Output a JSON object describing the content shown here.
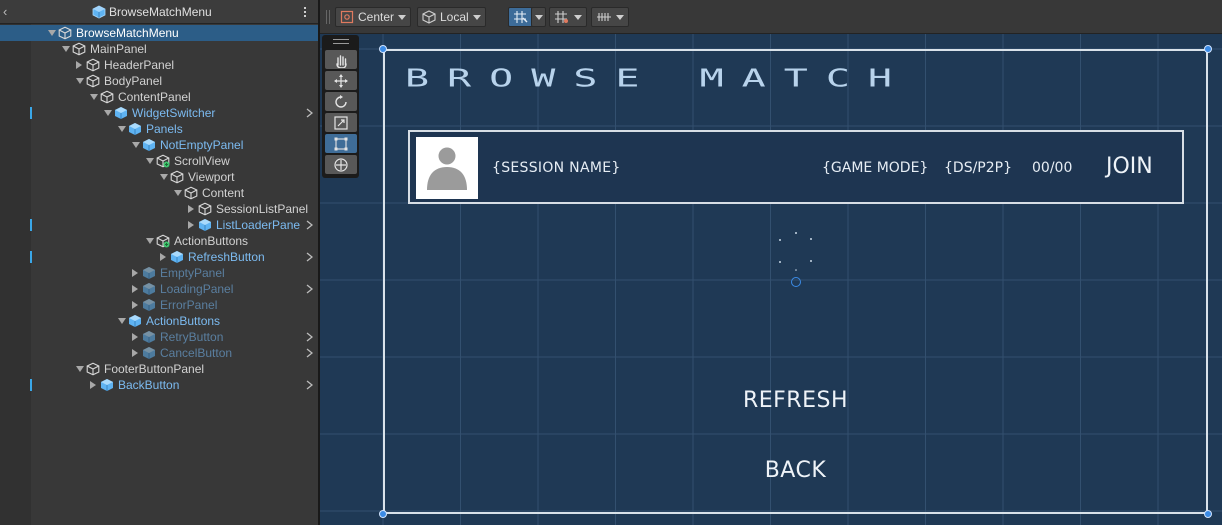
{
  "hierarchy": {
    "title": "BrowseMatchMenu",
    "items": [
      {
        "label": "BrowseMatchMenu",
        "depth": 0,
        "expand": "down",
        "kind": "normal",
        "selected": true,
        "mark": false,
        "chevron": false
      },
      {
        "label": "MainPanel",
        "depth": 1,
        "expand": "down",
        "kind": "normal",
        "selected": false,
        "mark": false,
        "chevron": false
      },
      {
        "label": "HeaderPanel",
        "depth": 2,
        "expand": "right",
        "kind": "normal",
        "selected": false,
        "mark": false,
        "chevron": false
      },
      {
        "label": "BodyPanel",
        "depth": 2,
        "expand": "down",
        "kind": "normal",
        "selected": false,
        "mark": false,
        "chevron": false
      },
      {
        "label": "ContentPanel",
        "depth": 3,
        "expand": "down",
        "kind": "normal",
        "selected": false,
        "mark": false,
        "chevron": false
      },
      {
        "label": "WidgetSwitcher",
        "depth": 4,
        "expand": "down",
        "kind": "prefab",
        "selected": false,
        "mark": true,
        "chevron": true
      },
      {
        "label": "Panels",
        "depth": 5,
        "expand": "down",
        "kind": "prefab",
        "selected": false,
        "mark": false,
        "chevron": false
      },
      {
        "label": "NotEmptyPanel",
        "depth": 6,
        "expand": "down",
        "kind": "prefab",
        "selected": false,
        "mark": false,
        "chevron": false
      },
      {
        "label": "ScrollView",
        "depth": 7,
        "expand": "down",
        "kind": "scroll",
        "selected": false,
        "mark": false,
        "chevron": false
      },
      {
        "label": "Viewport",
        "depth": 8,
        "expand": "down",
        "kind": "normal",
        "selected": false,
        "mark": false,
        "chevron": false
      },
      {
        "label": "Content",
        "depth": 9,
        "expand": "down",
        "kind": "normal",
        "selected": false,
        "mark": false,
        "chevron": false
      },
      {
        "label": "SessionListPanel",
        "depth": 10,
        "expand": "right",
        "kind": "normal",
        "selected": false,
        "mark": false,
        "chevron": false
      },
      {
        "label": "ListLoaderPane",
        "depth": 10,
        "expand": "right",
        "kind": "prefab",
        "selected": false,
        "mark": true,
        "chevron": true
      },
      {
        "label": "ActionButtons",
        "depth": 7,
        "expand": "down",
        "kind": "scroll",
        "selected": false,
        "mark": false,
        "chevron": false
      },
      {
        "label": "RefreshButton",
        "depth": 8,
        "expand": "right",
        "kind": "prefab",
        "selected": false,
        "mark": true,
        "chevron": true
      },
      {
        "label": "EmptyPanel",
        "depth": 6,
        "expand": "right",
        "kind": "prefab-dim",
        "selected": false,
        "mark": false,
        "chevron": false
      },
      {
        "label": "LoadingPanel",
        "depth": 6,
        "expand": "right",
        "kind": "prefab-dim",
        "selected": false,
        "mark": false,
        "chevron": true
      },
      {
        "label": "ErrorPanel",
        "depth": 6,
        "expand": "right",
        "kind": "prefab-dim",
        "selected": false,
        "mark": false,
        "chevron": false
      },
      {
        "label": "ActionButtons",
        "depth": 5,
        "expand": "down",
        "kind": "prefab",
        "selected": false,
        "mark": false,
        "chevron": false
      },
      {
        "label": "RetryButton",
        "depth": 6,
        "expand": "right",
        "kind": "prefab-dim",
        "selected": false,
        "mark": false,
        "chevron": true
      },
      {
        "label": "CancelButton",
        "depth": 6,
        "expand": "right",
        "kind": "prefab-dim",
        "selected": false,
        "mark": false,
        "chevron": true
      },
      {
        "label": "FooterButtonPanel",
        "depth": 2,
        "expand": "down",
        "kind": "normal",
        "selected": false,
        "mark": false,
        "chevron": false
      },
      {
        "label": "BackButton",
        "depth": 3,
        "expand": "right",
        "kind": "prefab",
        "selected": false,
        "mark": true,
        "chevron": true
      }
    ]
  },
  "toolbar": {
    "pivot_label": "Center",
    "space_label": "Local"
  },
  "tools": [
    "hand-tool",
    "move-tool",
    "rotate-tool",
    "scale-tool",
    "rect-tool",
    "transform-tool"
  ],
  "canvas": {
    "title": "BROWSE MATCH",
    "session_name": "{SESSION NAME}",
    "game_mode": "{GAME MODE}",
    "server_type": "{DS/P2P}",
    "players": "00/00",
    "join_label": "JOIN",
    "refresh_label": "REFRESH",
    "back_label": "BACK"
  },
  "colors": {
    "selection": "#2c5d87",
    "prefab_text": "#7cbbf1",
    "scene_background": "#1f3955",
    "handle": "#3b8be6"
  }
}
